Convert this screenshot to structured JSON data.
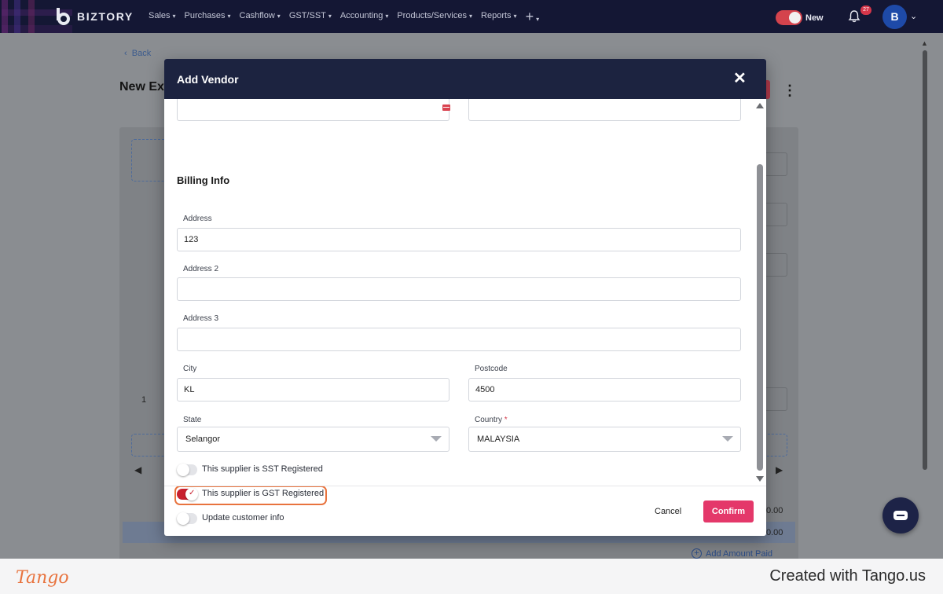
{
  "app": {
    "brand": "BIZTORY",
    "nav": [
      "Sales",
      "Purchases",
      "Cashflow",
      "GST/SST",
      "Accounting",
      "Products/Services",
      "Reports"
    ],
    "new_toggle_label": "New",
    "notification_count": "27",
    "avatar_initial": "B"
  },
  "page": {
    "back_label": "Back",
    "title": "New Exp",
    "row_number": "1",
    "amount_1": "0.00",
    "amount_2": "0.00",
    "add_amount_paid": "Add Amount Paid"
  },
  "modal": {
    "title": "Add Vendor",
    "section_title": "Billing Info",
    "fields": {
      "address": {
        "label": "Address",
        "value": "123"
      },
      "address2": {
        "label": "Address 2",
        "value": ""
      },
      "address3": {
        "label": "Address 3",
        "value": ""
      },
      "city": {
        "label": "City",
        "value": "KL"
      },
      "postcode": {
        "label": "Postcode",
        "value": "4500"
      },
      "state": {
        "label": "State",
        "value": "Selangor"
      },
      "country": {
        "label": "Country",
        "required": "*",
        "value": "MALAYSIA"
      }
    },
    "toggles": [
      {
        "label": "This supplier is SST Registered",
        "on": false
      },
      {
        "label": "This supplier is GST Registered",
        "on": true
      },
      {
        "label": "Update customer info",
        "on": false
      }
    ],
    "cancel_label": "Cancel",
    "confirm_label": "Confirm"
  },
  "footer": {
    "logo": "Tango",
    "credit": "Created with Tango.us"
  },
  "colors": {
    "nav_bg": "#141734",
    "modal_header": "#1c2340",
    "confirm": "#e4386a",
    "toggle_on": "#c8202f",
    "highlight": "#e8733e"
  }
}
